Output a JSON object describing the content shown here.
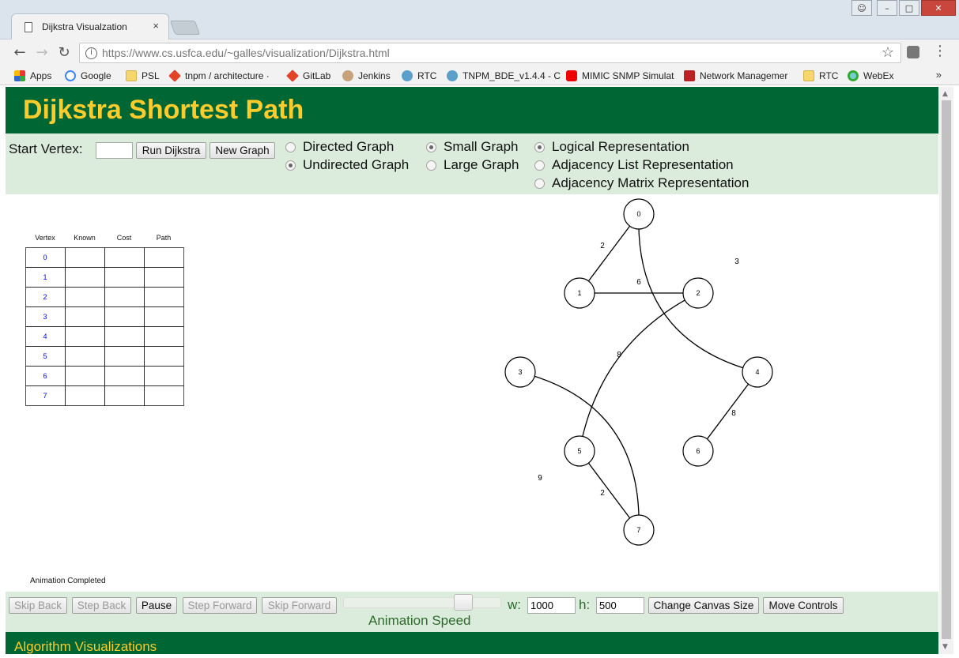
{
  "browser": {
    "tab_title": "Dijkstra Visualzation",
    "tab_close": "×",
    "url_host": "https://www.cs.usfca.edu",
    "url_path": "/~galles/visualization/Dijkstra.html",
    "bookmarks": [
      {
        "label": "Apps",
        "icon": "apps-icon"
      },
      {
        "label": "Google",
        "icon": "google-icon"
      },
      {
        "label": "PSL",
        "icon": "folder-icon"
      },
      {
        "label": "tnpm / architecture ·",
        "icon": "gitlab-icon"
      },
      {
        "label": "GitLab",
        "icon": "gitlab-icon"
      },
      {
        "label": "Jenkins",
        "icon": "jenkins-icon"
      },
      {
        "label": "RTC",
        "icon": "rtc-icon"
      },
      {
        "label": "TNPM_BDE_v1.4.4 - C",
        "icon": "rtc-icon"
      },
      {
        "label": "MIMIC SNMP Simulat",
        "icon": "youtube-icon"
      },
      {
        "label": "Network Managemer",
        "icon": "gic-icon"
      },
      {
        "label": "RTC",
        "icon": "folder-icon"
      },
      {
        "label": "WebEx",
        "icon": "webex-icon"
      }
    ],
    "more": "»"
  },
  "page": {
    "title": "Dijkstra Shortest Path",
    "controls": {
      "start_vertex_label": "Start Vertex:",
      "start_vertex_value": "",
      "run_button": "Run Dijkstra",
      "new_graph_button": "New Graph",
      "radios": {
        "directed": "Directed Graph",
        "undirected": "Undirected Graph",
        "small": "Small Graph",
        "large": "Large Graph",
        "logical": "Logical Representation",
        "adj_list": "Adjacency List Representation",
        "adj_matrix": "Adjacency Matrix Representation"
      },
      "selected": {
        "directed": false,
        "undirected": true,
        "small": true,
        "large": false,
        "logical": true,
        "adj_list": false,
        "adj_matrix": false
      }
    },
    "table": {
      "headers": [
        "Vertex",
        "Known",
        "Cost",
        "Path"
      ],
      "rows": [
        {
          "vertex": "0",
          "known": "",
          "cost": "",
          "path": ""
        },
        {
          "vertex": "1",
          "known": "",
          "cost": "",
          "path": ""
        },
        {
          "vertex": "2",
          "known": "",
          "cost": "",
          "path": ""
        },
        {
          "vertex": "3",
          "known": "",
          "cost": "",
          "path": ""
        },
        {
          "vertex": "4",
          "known": "",
          "cost": "",
          "path": ""
        },
        {
          "vertex": "5",
          "known": "",
          "cost": "",
          "path": ""
        },
        {
          "vertex": "6",
          "known": "",
          "cost": "",
          "path": ""
        },
        {
          "vertex": "7",
          "known": "",
          "cost": "",
          "path": ""
        }
      ]
    },
    "graph": {
      "vertices": [
        "0",
        "1",
        "2",
        "3",
        "4",
        "5",
        "6",
        "7"
      ],
      "edges": [
        {
          "from": "0",
          "to": "1",
          "weight": "2"
        },
        {
          "from": "0",
          "to": "4",
          "weight": "3"
        },
        {
          "from": "1",
          "to": "2",
          "weight": "6"
        },
        {
          "from": "2",
          "to": "5",
          "weight": "8"
        },
        {
          "from": "4",
          "to": "6",
          "weight": "8"
        },
        {
          "from": "3",
          "to": "7",
          "weight": "9"
        },
        {
          "from": "5",
          "to": "7",
          "weight": "2"
        }
      ]
    },
    "status": "Animation Completed",
    "animation": {
      "skip_back": "Skip Back",
      "step_back": "Step Back",
      "pause": "Pause",
      "step_forward": "Step Forward",
      "skip_forward": "Skip Forward",
      "speed_label": "Animation Speed",
      "speed_fraction": 0.75,
      "w_label": "w:",
      "w_value": "1000",
      "h_label": "h:",
      "h_value": "500",
      "change_canvas": "Change Canvas Size",
      "move_controls": "Move Controls"
    },
    "footer": "Algorithm Visualizations"
  },
  "colors": {
    "header_bg": "#006633",
    "header_text": "#fccb2c",
    "controls_bg": "#dcecdc",
    "table_index": "#0000ff"
  }
}
